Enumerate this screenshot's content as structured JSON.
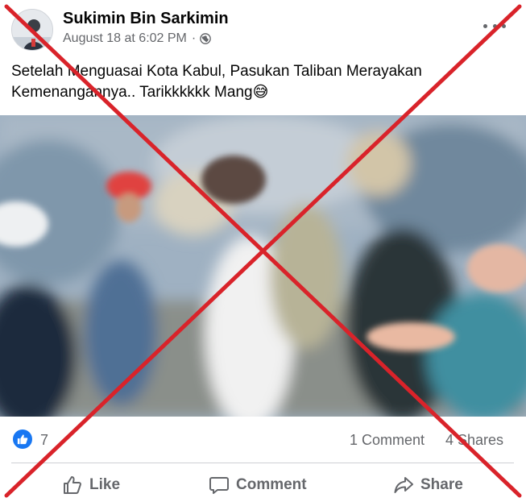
{
  "post": {
    "author": "Sukimin Bin Sarkimin",
    "timestamp": "August 18 at 6:02 PM",
    "separator": "·",
    "audience_icon": "globe-icon",
    "more_icon": "more-options-icon",
    "caption_line1": "Setelah Menguasai Kota Kabul, Pasukan Taliban Merayakan",
    "caption_line2": "Kemenangannya.. Tarikkkkkk Mang😅"
  },
  "media": {
    "type": "video",
    "mute_icon": "volume-muted-icon"
  },
  "stats": {
    "reaction_icon": "like-reaction-icon",
    "reaction_count": "7",
    "comments": "1 Comment",
    "shares": "4 Shares"
  },
  "actions": {
    "like_label": "Like",
    "comment_label": "Comment",
    "share_label": "Share"
  },
  "overlay": {
    "type": "red-x-mark",
    "color": "#d9232a"
  },
  "colors": {
    "accent": "#1877f2",
    "secondary_text": "#65676b",
    "primary_text": "#050505",
    "divider": "#ced0d4"
  }
}
